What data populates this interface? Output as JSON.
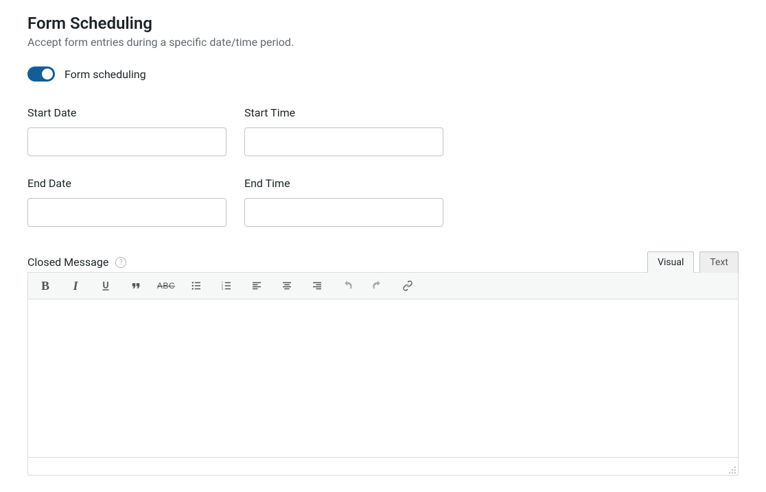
{
  "header": {
    "title": "Form Scheduling",
    "description": "Accept form entries during a specific date/time period."
  },
  "toggle": {
    "label": "Form scheduling",
    "enabled": true
  },
  "fields": {
    "start_date": {
      "label": "Start Date",
      "value": ""
    },
    "start_time": {
      "label": "Start Time",
      "value": ""
    },
    "end_date": {
      "label": "End Date",
      "value": ""
    },
    "end_time": {
      "label": "End Time",
      "value": ""
    }
  },
  "closed_message": {
    "label": "Closed Message",
    "help_glyph": "?"
  },
  "editor": {
    "tabs": {
      "visual": "Visual",
      "text": "Text",
      "active": "visual"
    },
    "content": "",
    "toolbar": {
      "bold": "B",
      "italic": "I",
      "strike": "ABC"
    }
  }
}
